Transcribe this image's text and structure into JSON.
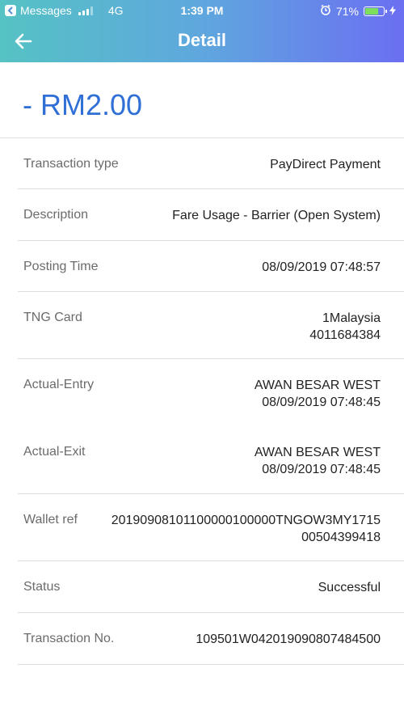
{
  "status_bar": {
    "back_app": "Messages",
    "network": "4G",
    "time": "1:39 PM",
    "battery": "71%",
    "battery_level": 0.71
  },
  "nav": {
    "title": "Detail"
  },
  "amount": "- RM2.00",
  "details": {
    "transaction_type": {
      "label": "Transaction type",
      "value": "PayDirect Payment"
    },
    "description": {
      "label": "Description",
      "value": "Fare Usage - Barrier (Open System)"
    },
    "posting_time": {
      "label": "Posting Time",
      "value": "08/09/2019 07:48:57"
    },
    "tng_card": {
      "label": "TNG Card",
      "line1": "1Malaysia",
      "line2": "4011684384"
    },
    "actual_entry": {
      "label": "Actual-Entry",
      "line1": "AWAN BESAR WEST",
      "line2": "08/09/2019 07:48:45"
    },
    "actual_exit": {
      "label": "Actual-Exit",
      "line1": "AWAN BESAR WEST",
      "line2": "08/09/2019 07:48:45"
    },
    "wallet_ref": {
      "label": "Wallet ref",
      "line1": "20190908101100000100000TNGOW3MY1715",
      "line2": "00504399418"
    },
    "status": {
      "label": "Status",
      "value": "Successful"
    },
    "transaction_no": {
      "label": "Transaction No.",
      "value": "109501W042019090807484500"
    }
  },
  "colors": {
    "header_gradient_start": "#55c2c4",
    "header_gradient_end": "#6b6ff2",
    "amount": "#2f6fd6",
    "battery": "#7ee05a"
  }
}
